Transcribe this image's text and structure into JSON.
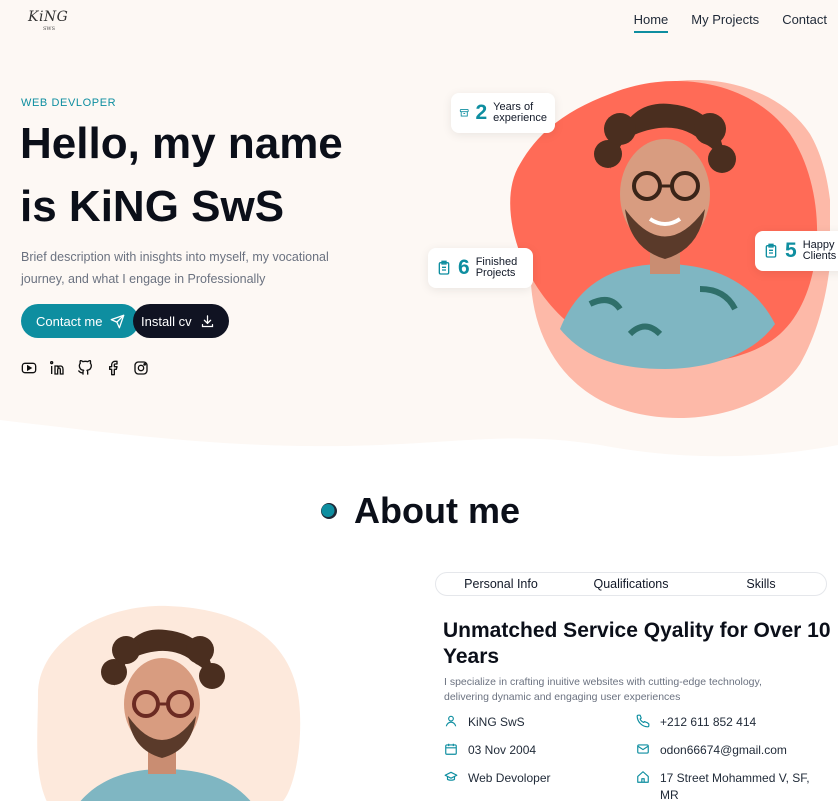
{
  "logo": {
    "text": "KiNG",
    "sub": "SWS"
  },
  "nav": {
    "items": [
      "Home",
      "My Projects",
      "Contact"
    ],
    "active": "Home"
  },
  "hero": {
    "subtitle": "WEB DEVLOPER",
    "headline_line1": "Hello, my name",
    "headline_line2": "is KiNG SwS",
    "description": "Brief description with inisghts into myself, my vocational journey, and what I engage in Professionally",
    "contact_label": "Contact me",
    "cv_label": "Install cv",
    "socials": [
      "youtube-icon",
      "linkedin-icon",
      "github-icon",
      "facebook-icon",
      "instagram-icon"
    ]
  },
  "stats": [
    {
      "number": "2",
      "label_line1": "Years of",
      "label_line2": "experience"
    },
    {
      "number": "6",
      "label_line1": "Finished",
      "label_line2": "Projects"
    },
    {
      "number": "5",
      "label_line1": "Happy",
      "label_line2": "Clients"
    }
  ],
  "about": {
    "title": "About me",
    "tabs": [
      "Personal Info",
      "Qualifications",
      "Skills"
    ],
    "heading": "Unmatched Service Qyality for Over 10 Years",
    "description": "I specialize in crafting inuitive websites with cutting-edge technology, delivering dynamic and engaging user experiences",
    "items": {
      "name": "KiNG SwS",
      "date": "03 Nov 2004",
      "job": "Web Devoloper",
      "phone": "+212 611 852 414",
      "email": "odon66674@gmail.com",
      "address": "17 Street Mohammed V, SF, MR"
    }
  },
  "colors": {
    "accent": "#0e8ea0",
    "coral": "#ff6b57",
    "peach": "#fdb9a8",
    "cream": "#fdf8f4",
    "dark": "#101322"
  }
}
